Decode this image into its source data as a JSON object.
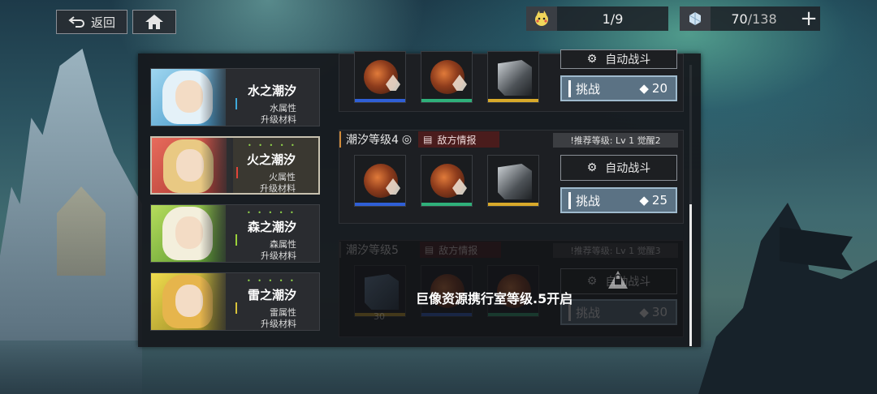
{
  "top_bar": {
    "back_label": "返回",
    "stamina": {
      "current": "1",
      "separator": "/",
      "max": "9",
      "icon": "pikachu-stamina-icon"
    },
    "crystal": {
      "current": "70",
      "separator": "/",
      "max": "138",
      "icon": "crystal-icon"
    },
    "plus_label": "+"
  },
  "elements": [
    {
      "name": "水之潮汐",
      "attr": "水属性",
      "material": "升级材料",
      "stars": "• • • • •",
      "accent": "#3fa9d9",
      "hair": "#d9e9f2"
    },
    {
      "name": "火之潮汐",
      "attr": "火属性",
      "material": "升级材料",
      "stars": "• • • • •",
      "accent": "#e0443a",
      "hair": "#e6c27a"
    },
    {
      "name": "森之潮汐",
      "attr": "森属性",
      "material": "升级材料",
      "stars": "• • • • •",
      "accent": "#9bd23a",
      "hair": "#f1eee0"
    },
    {
      "name": "雷之潮汐",
      "attr": "雷属性",
      "material": "升级材料",
      "stars": "• • • • •",
      "accent": "#d8c33a",
      "hair": "#e1b14a"
    }
  ],
  "stages": [
    {
      "auto_label": "自动战斗",
      "challenge_label": "挑战",
      "cost": "20"
    },
    {
      "title": "潮汐等级4",
      "intel_label": "敌方情报",
      "recommend": "!推荐等级: Lv 1 觉醒2",
      "auto_label": "自动战斗",
      "challenge_label": "挑战",
      "cost": "25"
    },
    {
      "title": "潮汐等级5",
      "intel_label": "敌方情报",
      "recommend": "!推荐等级: Lv 1 觉醒3",
      "auto_label": "自动战斗",
      "challenge_label": "挑战",
      "cost": "30",
      "reward_count": "30",
      "lock_message": "巨像资源携行室等级.5开启"
    }
  ],
  "colors": {
    "reward_blue": "#2f5fd6",
    "reward_green": "#2fb07a",
    "reward_gold": "#d8a92a",
    "challenge_bg": "#5b7284"
  }
}
